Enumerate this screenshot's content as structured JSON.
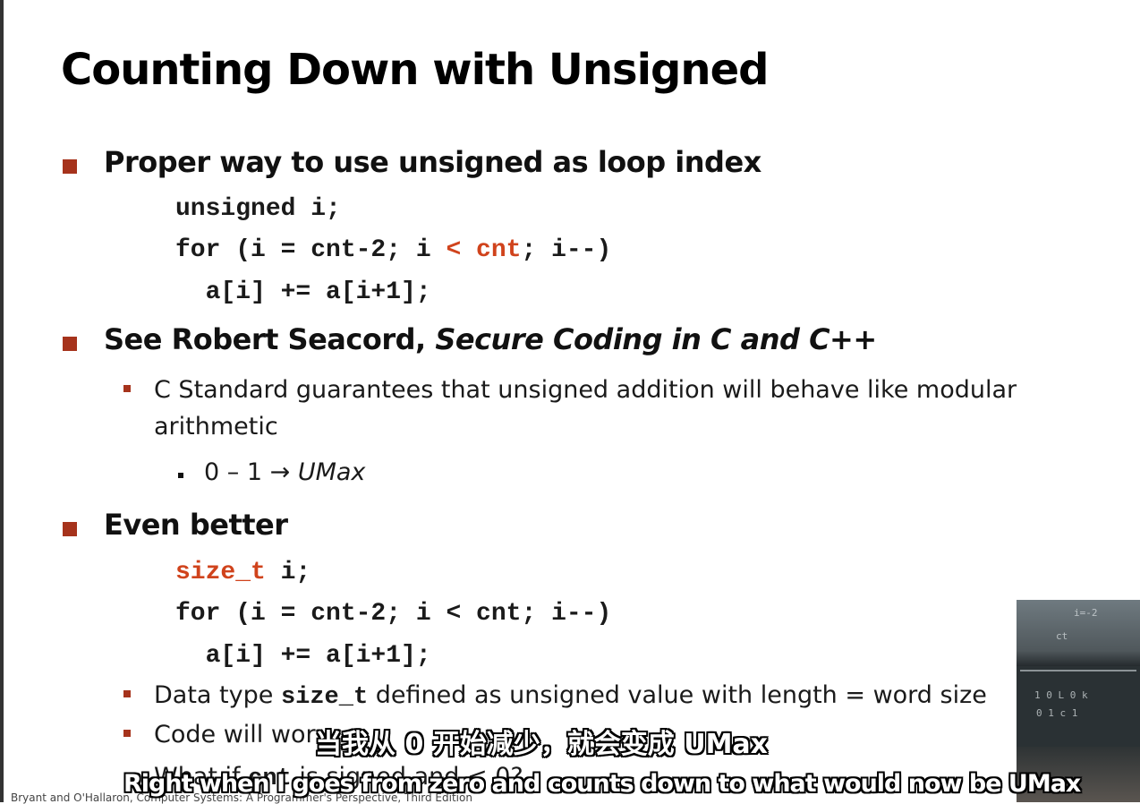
{
  "slide": {
    "title": "Counting Down with Unsigned",
    "bullet1": "Proper way to use unsigned as loop index",
    "code1": {
      "line1": "unsigned i;",
      "line2_a": "for (i = cnt-2; i ",
      "line2_red": "< cnt",
      "line2_b": "; i--)",
      "line3": "  a[i] += a[i+1];"
    },
    "bullet2_plain": "See Robert Seacord, ",
    "bullet2_italic": "Secure Coding in C and C++",
    "sub1_line1": "C Standard guarantees that unsigned addition will behave like modular",
    "sub1_line2": "arithmetic",
    "subsub1_plain": "0 – 1 → ",
    "subsub1_italic": "UMax",
    "bullet3": "Even better",
    "code2": {
      "line1_red": "size_t",
      "line1_b": " i;",
      "line2": "for (i = cnt-2; i < cnt; i--)",
      "line3": "  a[i] += a[i+1];"
    },
    "sub2_a": "Data type ",
    "sub2_mono": "size_t",
    "sub2_b": " defined as unsigned value with length = word size",
    "sub3": "Code will wor",
    "sub4_a": "What if ",
    "sub4_mono": "cnt",
    "sub4_b": " is signed and < 0?",
    "footer": "Bryant and O'Hallaron, Computer Systems: A Programmer's Perspective, Third Edition"
  },
  "subtitles": {
    "chinese": "当我从 0 开始减少，就会变成 UMax",
    "english": "Right when I goes from zero and counts down to what would now be UMax"
  },
  "webcam": {
    "board_text_1": "i=-2",
    "board_text_2": "ct",
    "board_text_3": "1 0 L 0 k",
    "board_text_4": "0 1 c 1"
  },
  "colors": {
    "accent_red": "#a6331c",
    "code_red": "#d0431c"
  }
}
